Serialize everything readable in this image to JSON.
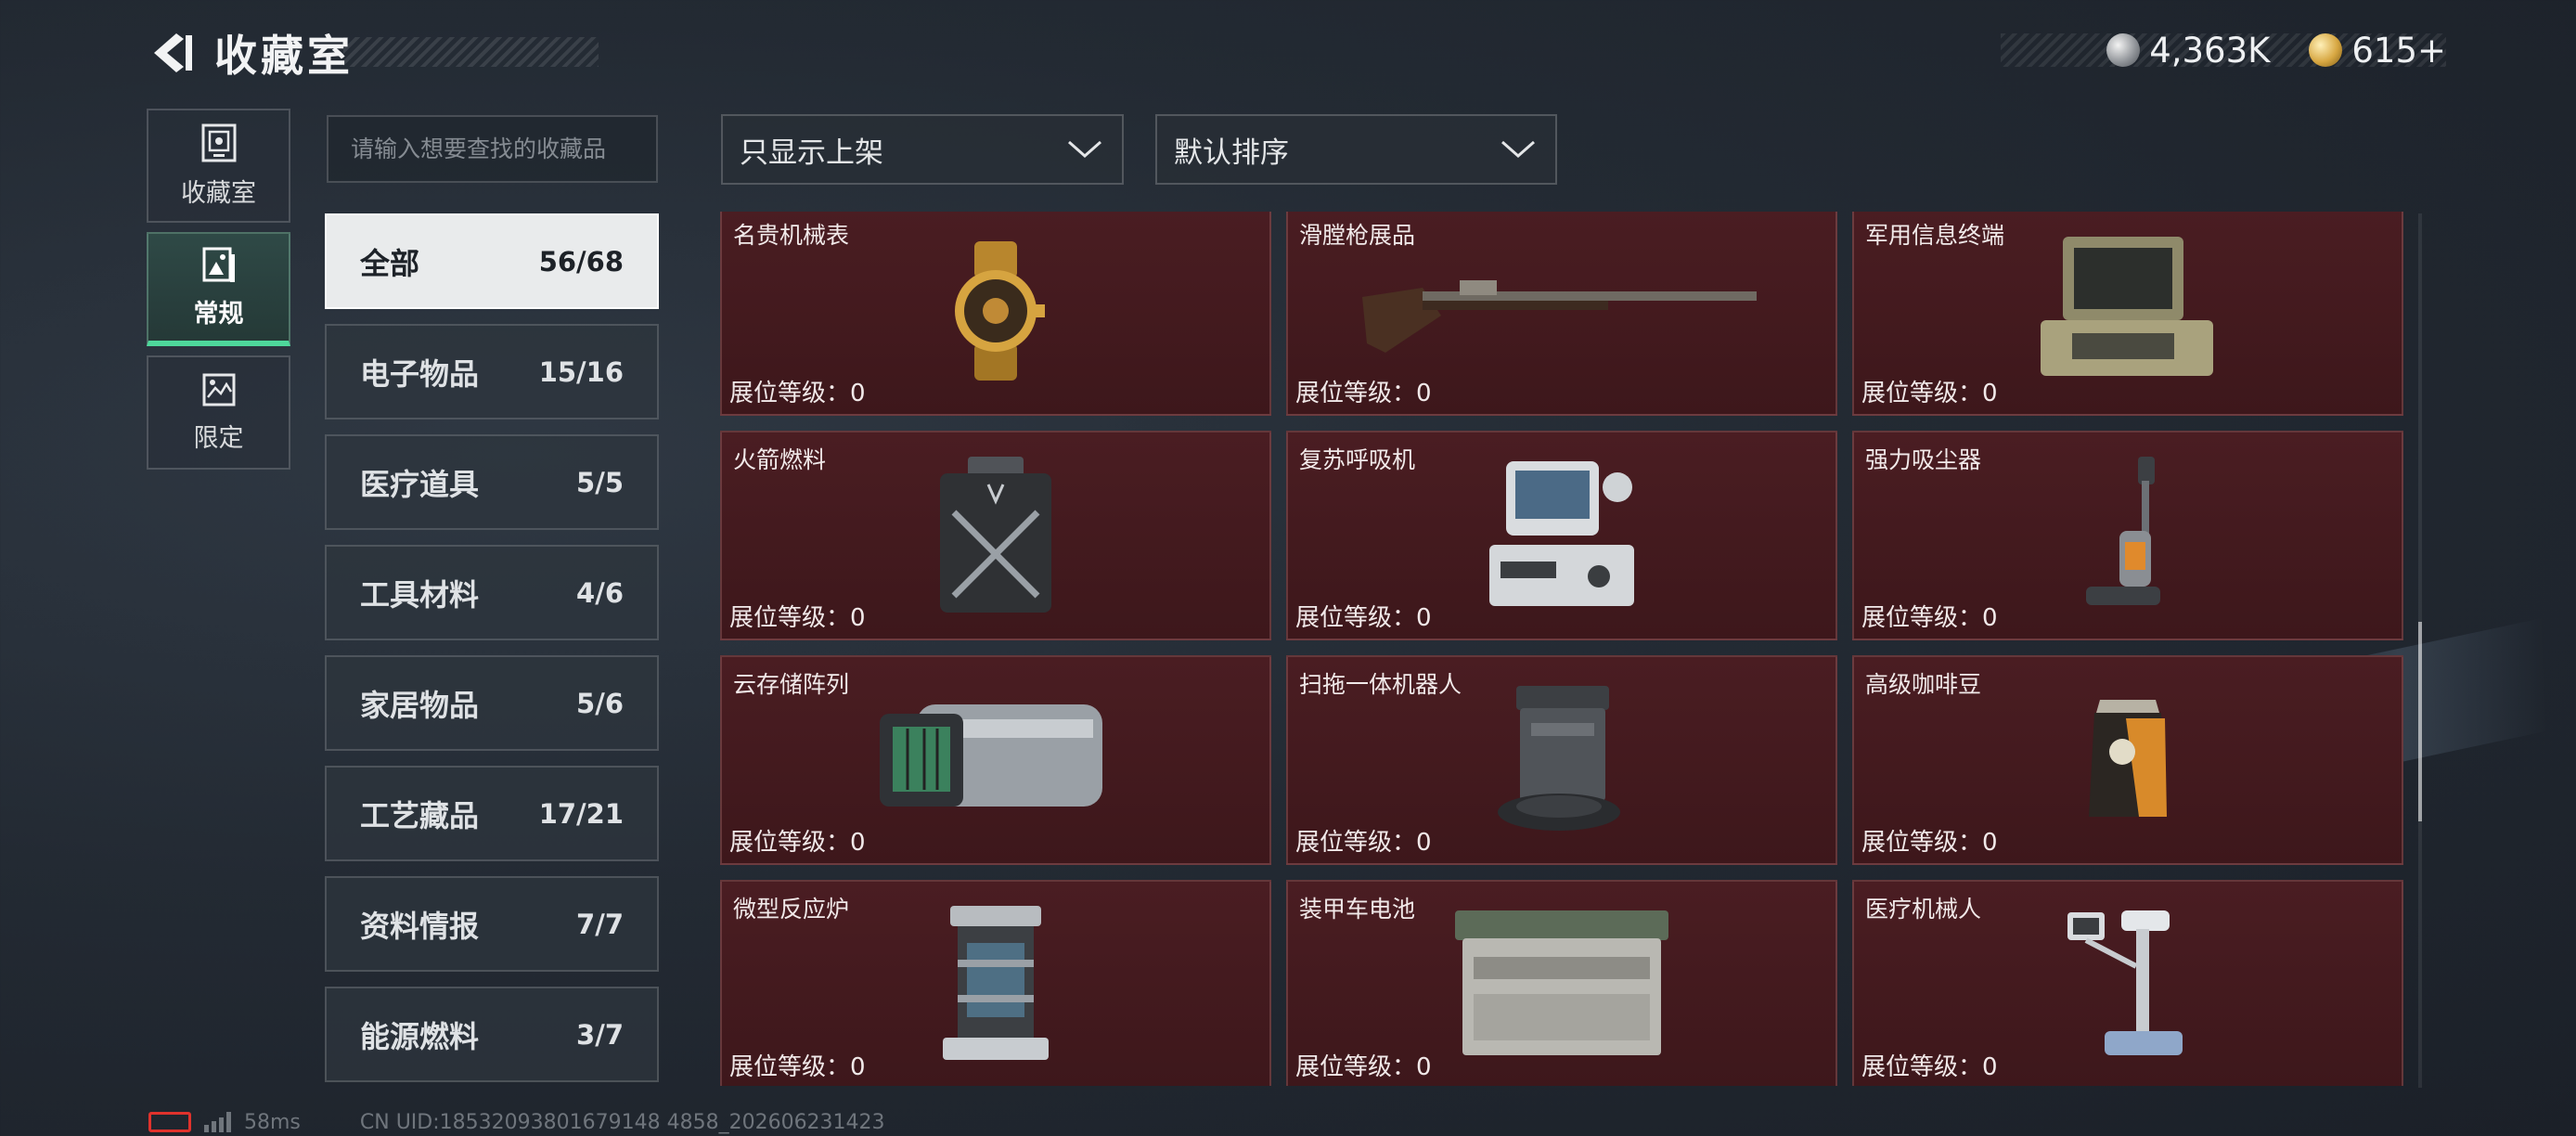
{
  "header": {
    "title": "收藏室",
    "back_icon": "back-arrow-icon"
  },
  "currency": [
    {
      "icon": "silver-coin-icon",
      "value": "4,363K"
    },
    {
      "icon": "gold-coin-icon",
      "value": "615+"
    }
  ],
  "side_nav": [
    {
      "label": "收藏室",
      "icon": "vault-icon",
      "active": false
    },
    {
      "label": "常规",
      "icon": "document-icon",
      "active": true
    },
    {
      "label": "限定",
      "icon": "gallery-icon",
      "active": false
    }
  ],
  "search": {
    "placeholder": "请输入想要查找的收藏品"
  },
  "categories": [
    {
      "label": "全部",
      "count": "56/68",
      "active": true
    },
    {
      "label": "电子物品",
      "count": "15/16"
    },
    {
      "label": "医疗道具",
      "count": "5/5"
    },
    {
      "label": "工具材料",
      "count": "4/6"
    },
    {
      "label": "家居物品",
      "count": "5/6"
    },
    {
      "label": "工艺藏品",
      "count": "17/21"
    },
    {
      "label": "资料情报",
      "count": "7/7"
    },
    {
      "label": "能源燃料",
      "count": "3/7"
    }
  ],
  "filters": {
    "display_filter": "只显示上架",
    "sort": "默认排序"
  },
  "items": [
    {
      "name": "名贵机械表",
      "level": "展位等级：0",
      "icon": "watch-icon"
    },
    {
      "name": "滑膛枪展品",
      "level": "展位等级：0",
      "icon": "musket-icon"
    },
    {
      "name": "军用信息终端",
      "level": "展位等级：0",
      "icon": "terminal-icon"
    },
    {
      "name": "火箭燃料",
      "level": "展位等级：0",
      "icon": "fuel-can-icon"
    },
    {
      "name": "复苏呼吸机",
      "level": "展位等级：0",
      "icon": "ventilator-icon"
    },
    {
      "name": "强力吸尘器",
      "level": "展位等级：0",
      "icon": "vacuum-icon"
    },
    {
      "name": "云存储阵列",
      "level": "展位等级：0",
      "icon": "storage-array-icon"
    },
    {
      "name": "扫拖一体机器人",
      "level": "展位等级：0",
      "icon": "robot-vacuum-icon"
    },
    {
      "name": "高级咖啡豆",
      "level": "展位等级：0",
      "icon": "coffee-bag-icon"
    },
    {
      "name": "微型反应炉",
      "level": "展位等级：0",
      "icon": "reactor-icon"
    },
    {
      "name": "装甲车电池",
      "level": "展位等级：0",
      "icon": "battery-icon"
    },
    {
      "name": "医疗机械人",
      "level": "展位等级：0",
      "icon": "medical-robot-icon"
    }
  ],
  "footer": {
    "ping": "58ms",
    "uid": "CN UID:18532093801679148 4858_202606231423"
  },
  "colors": {
    "accent_green": "#4ed79b",
    "card_bg": "#4a1d22",
    "battery_red": "#e0322c"
  }
}
